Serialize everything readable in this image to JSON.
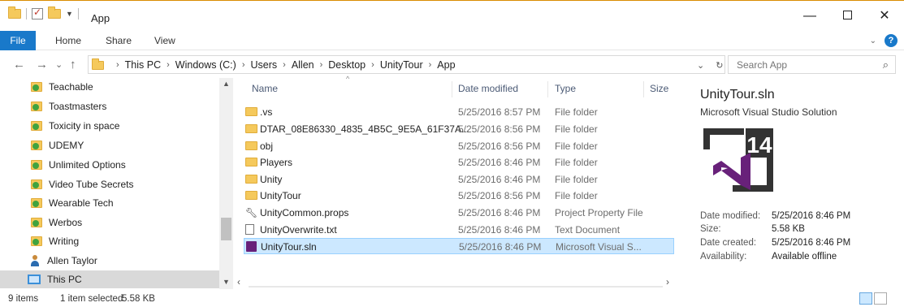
{
  "window": {
    "title": "App",
    "min_glyph": "—",
    "close_glyph": "✕"
  },
  "ribbon": {
    "tabs": [
      "File",
      "Home",
      "Share",
      "View"
    ]
  },
  "nav": {
    "back": "←",
    "forward": "→",
    "recent": "⌄",
    "up": "↑"
  },
  "address": {
    "crumbs": [
      "This PC",
      "Windows (C:)",
      "Users",
      "Allen",
      "Desktop",
      "UnityTour",
      "App"
    ],
    "sep": "›",
    "refresh": "↻",
    "dropdown": "⌄"
  },
  "search": {
    "placeholder": "Search App"
  },
  "sidebar": {
    "items": [
      {
        "label": "Teachable",
        "icon": "sync-folder-icon"
      },
      {
        "label": "Toastmasters",
        "icon": "sync-folder-icon"
      },
      {
        "label": "Toxicity in space",
        "icon": "sync-folder-icon"
      },
      {
        "label": "UDEMY",
        "icon": "sync-folder-icon"
      },
      {
        "label": "Unlimited Options",
        "icon": "sync-folder-icon"
      },
      {
        "label": "Video Tube Secrets",
        "icon": "sync-folder-icon"
      },
      {
        "label": "Wearable Tech",
        "icon": "sync-folder-icon"
      },
      {
        "label": "Werbos",
        "icon": "sync-folder-icon"
      },
      {
        "label": "Writing",
        "icon": "sync-folder-icon"
      },
      {
        "label": "Allen Taylor",
        "icon": "user-icon"
      },
      {
        "label": "This PC",
        "icon": "computer-icon"
      }
    ]
  },
  "files": {
    "columns": [
      "Name",
      "Date modified",
      "Type",
      "Size"
    ],
    "rows": [
      {
        "name": ".vs",
        "date": "5/25/2016 8:57 PM",
        "type": "File folder",
        "icon": "folder-icon"
      },
      {
        "name": "DTAR_08E86330_4835_4B5C_9E5A_61F37A...",
        "date": "5/25/2016 8:56 PM",
        "type": "File folder",
        "icon": "folder-icon"
      },
      {
        "name": "obj",
        "date": "5/25/2016 8:56 PM",
        "type": "File folder",
        "icon": "folder-icon"
      },
      {
        "name": "Players",
        "date": "5/25/2016 8:46 PM",
        "type": "File folder",
        "icon": "folder-icon"
      },
      {
        "name": "Unity",
        "date": "5/25/2016 8:46 PM",
        "type": "File folder",
        "icon": "folder-icon"
      },
      {
        "name": "UnityTour",
        "date": "5/25/2016 8:56 PM",
        "type": "File folder",
        "icon": "folder-icon"
      },
      {
        "name": "UnityCommon.props",
        "date": "5/25/2016 8:46 PM",
        "type": "Project Property File",
        "icon": "wrench-icon"
      },
      {
        "name": "UnityOverwrite.txt",
        "date": "5/25/2016 8:46 PM",
        "type": "Text Document",
        "icon": "text-file-icon"
      },
      {
        "name": "UnityTour.sln",
        "date": "5/25/2016 8:46 PM",
        "type": "Microsoft Visual S...",
        "icon": "visual-studio-solution-icon",
        "selected": true
      }
    ]
  },
  "details": {
    "title": "UnityTour.sln",
    "subtitle": "Microsoft Visual Studio Solution",
    "version_badge": "14",
    "props": [
      {
        "label": "Date modified:",
        "value": "5/25/2016 8:46 PM"
      },
      {
        "label": "Size:",
        "value": "5.58 KB"
      },
      {
        "label": "Date created:",
        "value": "5/25/2016 8:46 PM"
      },
      {
        "label": "Availability:",
        "value": "Available offline"
      }
    ]
  },
  "status": {
    "item_count": "9 items",
    "selection": "1 item selected",
    "size": "5.58 KB"
  },
  "colors": {
    "accent": "#1979ca",
    "selection": "#cce8ff",
    "vs_purple": "#68217a",
    "folder": "#f5c95c"
  }
}
